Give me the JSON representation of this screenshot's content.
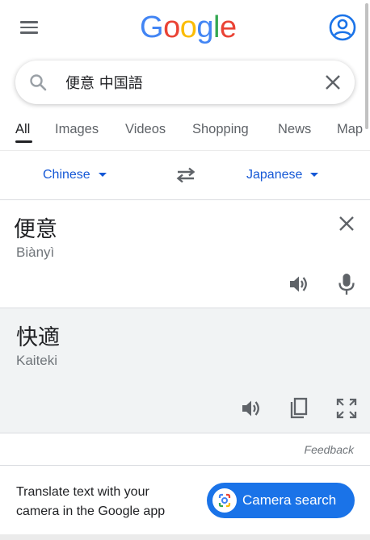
{
  "header": {
    "logo_letters": [
      "G",
      "o",
      "o",
      "g",
      "l",
      "e"
    ],
    "logo_colors": [
      "#4285F4",
      "#EA4335",
      "#FBBC05",
      "#4285F4",
      "#34A853",
      "#EA4335"
    ]
  },
  "search": {
    "query": "便意 中国語"
  },
  "tabs": [
    {
      "label": "All",
      "active": true
    },
    {
      "label": "Images",
      "active": false
    },
    {
      "label": "Videos",
      "active": false
    },
    {
      "label": "Shopping",
      "active": false
    },
    {
      "label": "News",
      "active": false
    },
    {
      "label": "Map",
      "active": false
    }
  ],
  "translate": {
    "source_lang": "Chinese",
    "target_lang": "Japanese",
    "source_text": "便意",
    "source_transliteration": "Biànyì",
    "target_text": "快適",
    "target_transliteration": "Kaiteki"
  },
  "feedback": {
    "label": "Feedback"
  },
  "promo": {
    "text": "Translate text with your camera in the Google app",
    "button_label": "Camera search"
  },
  "colors": {
    "link_blue": "#1558d6",
    "button_blue": "#1a73e8",
    "icon_gray": "#5f6368",
    "panel_gray": "#f1f3f4"
  },
  "icons": [
    "menu-icon",
    "google-logo",
    "account-icon",
    "search-icon",
    "close-icon",
    "swap-icon",
    "speaker-icon",
    "mic-icon",
    "copy-icon",
    "fullscreen-icon",
    "google-lens-icon"
  ]
}
